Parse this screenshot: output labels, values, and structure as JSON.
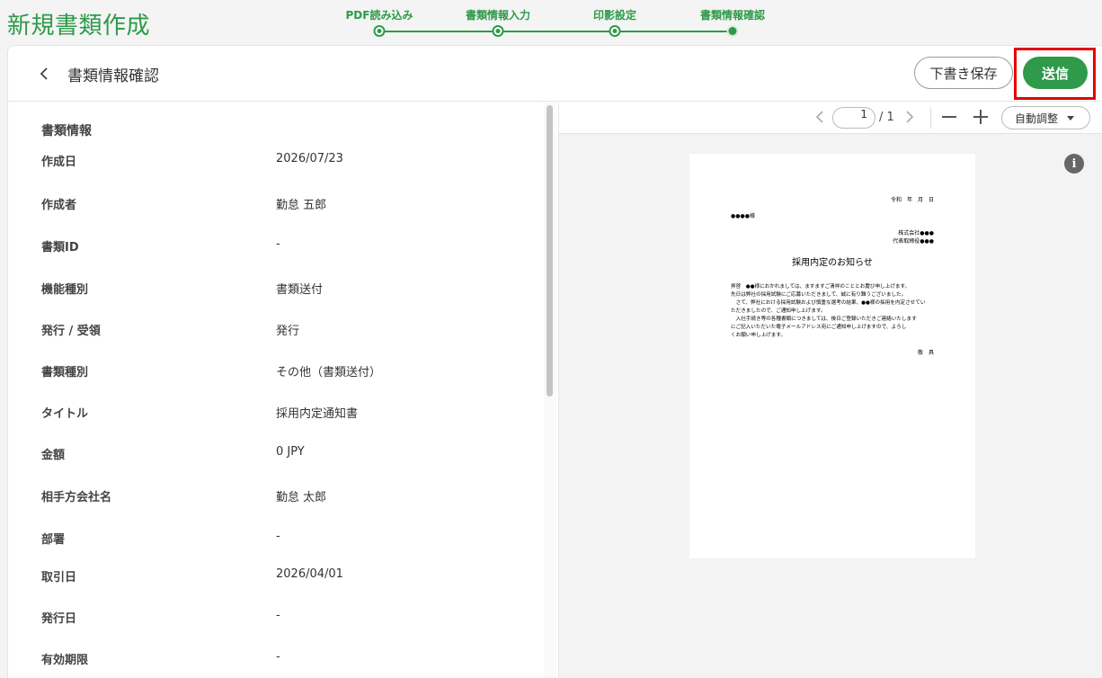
{
  "app_title": "新規書類作成",
  "stepper": {
    "steps": [
      {
        "label": "PDF読み込み"
      },
      {
        "label": "書類情報入力"
      },
      {
        "label": "印影設定"
      },
      {
        "label": "書類情報確認"
      }
    ],
    "current_step": 4
  },
  "header": {
    "title": "書類情報確認",
    "draft_label": "下書き保存",
    "send_label": "送信"
  },
  "info": {
    "section_title": "書類情報",
    "fields": [
      {
        "label": "作成日",
        "value": "2026/07/23"
      },
      {
        "label": "作成者",
        "value": "勤怠 五郎"
      },
      {
        "label": "書類ID",
        "value": "-"
      },
      {
        "label": "機能種別",
        "value": "書類送付"
      },
      {
        "label": "発行 / 受領",
        "value": "発行"
      },
      {
        "label": "書類種別",
        "value": "その他（書類送付）"
      },
      {
        "label": "タイトル",
        "value": "採用内定通知書"
      },
      {
        "label": "金額",
        "value": "0 JPY"
      },
      {
        "label": "相手方会社名",
        "value": "勤怠 太郎"
      },
      {
        "label": "部署",
        "value": "-"
      },
      {
        "label": "取引日",
        "value": "2026/04/01"
      },
      {
        "label": "発行日",
        "value": "-"
      },
      {
        "label": "有効期限",
        "value": "-"
      }
    ]
  },
  "viewer": {
    "page_current": "1",
    "page_total": "/ 1",
    "zoom_label": "自動調整"
  },
  "document": {
    "date_line": "令和　年　月　日",
    "recipient": "●●●●様",
    "company": "株式会社●●●",
    "representative": "代表取締役●●●",
    "title": "採用内定のお知らせ",
    "body": [
      "拝啓　●●様におかれましては、ますますご清祥のこととお慶び申し上げます。",
      "先日は弊社の採用試験にご応募いただきまして、誠に有り難うございました。",
      "　さて、弊社における採用試験および慎重な選考の結果、●●様の採用を内定させてい",
      "ただきましたので、ご通知申し上げます。",
      "　入社手続き等の各種書類につきましては、後日ご登録いただきご連絡いたします",
      "にご記入いただいた電子メールアドレス宛にご通知申し上げますので、よろし",
      "くお願い申し上げます。"
    ],
    "closing": "敬　具"
  }
}
